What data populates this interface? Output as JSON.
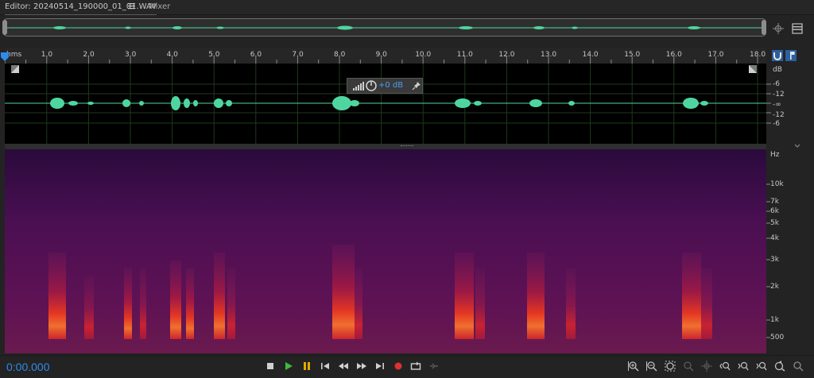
{
  "tabs": {
    "editor_label": "Editor: 20240514_190000_01_01.WAV",
    "mixer_label": "Mixer"
  },
  "icons": {
    "menu": "hamburger-icon",
    "crosshair": "crosshair-move-icon",
    "panel": "panel-toggle-icon",
    "magnet": "snap-magnet-icon",
    "marker": "marker-flag-icon"
  },
  "ruler": {
    "unit": "hms",
    "ticks": [
      "1.0",
      "2.0",
      "3.0",
      "4.0",
      "5.0",
      "6.0",
      "7.0",
      "8.0",
      "9.0",
      "10.0",
      "11.0",
      "12.0",
      "13.0",
      "14.0",
      "15.0",
      "16.0",
      "17.0",
      "18.0"
    ]
  },
  "waveform": {
    "db_labels": [
      "dB",
      "-6",
      "-12",
      "-∞",
      "-12",
      "-6"
    ],
    "hud_value": "+0 dB",
    "color": "#4fd6a0"
  },
  "spectral": {
    "hz_labels": [
      "Hz",
      "10k",
      "7k",
      "6k",
      "5k",
      "4k",
      "3k",
      "2k",
      "1k",
      "500"
    ]
  },
  "transport": {
    "timecode": "0:00.000",
    "accent": "#2d8ceb"
  }
}
